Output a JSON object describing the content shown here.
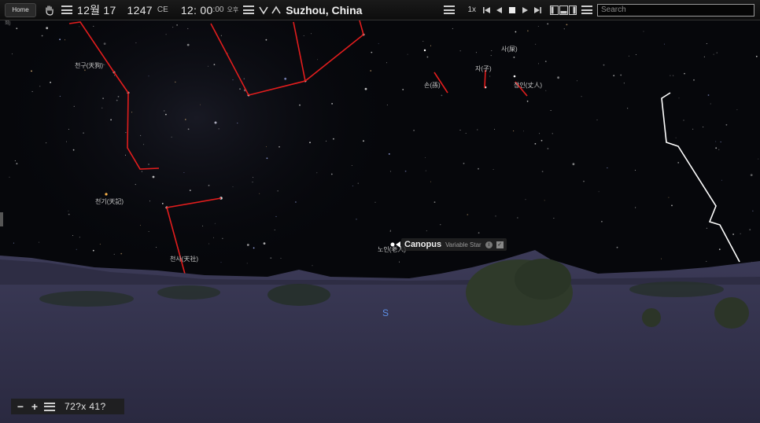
{
  "toolbar": {
    "home_label": "Home",
    "date_month": "12월",
    "date_day": "17",
    "year": "1247",
    "era": "CE",
    "time_hm": "12: 00",
    "time_sec": ":00",
    "ampm": "오후",
    "location": "Suzhou, China",
    "speed": "1x",
    "search_placeholder": "Search"
  },
  "sky_labels": {
    "topleft_partial": "희)",
    "tiangou": "천구(天狗)",
    "tianji": "천기(天記)",
    "tianshe": "천사(天社)",
    "sun": "손(孫)",
    "zi": "자(子)",
    "shi": "사(屎)",
    "zhangren": "장인(丈人)",
    "laoren": "노인(老人)"
  },
  "tooltip": {
    "name": "Canopus",
    "type": "Variable Star",
    "info_icon": "i",
    "check_icon": "✓"
  },
  "compass": {
    "south": "S"
  },
  "zoom": {
    "minus": "−",
    "plus": "+",
    "fov": "72?x 41?"
  },
  "colors": {
    "constellation_line": "#e21d1d",
    "asterism_line": "#ffffff",
    "ground": "#302f4a",
    "sky": "#06070b",
    "compass": "#5d8fe6"
  }
}
